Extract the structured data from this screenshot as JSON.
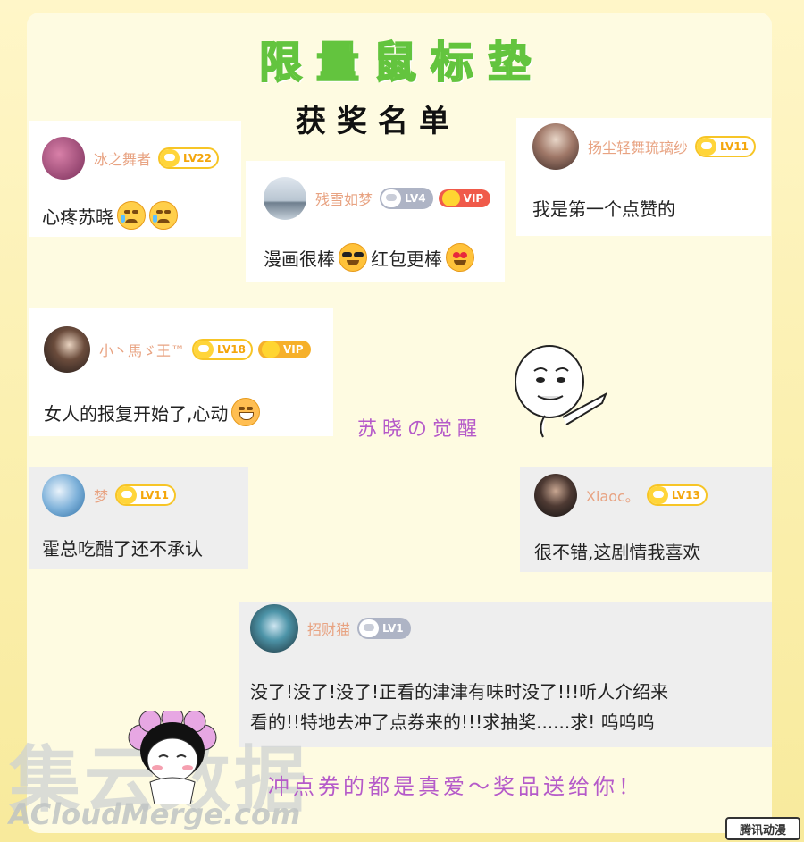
{
  "title": "限量鼠标垫",
  "subtitle": "获奖名单",
  "cards": [
    {
      "user": "冰之舞者",
      "level": "LV22",
      "comment": "心疼苏晓",
      "avatar_color": "#b0527a"
    },
    {
      "user": "残雪如梦",
      "level": "LV4",
      "vip": "VIP",
      "comment_a": "漫画很棒",
      "comment_b": "红包更棒",
      "avatar_color": "#9aa8b6"
    },
    {
      "user": "扬尘轻舞琉璃纱",
      "level": "LV11",
      "comment": "我是第一个点赞的",
      "avatar_color": "#8a6a5a"
    },
    {
      "user": "小丶馬ゞ王™",
      "level": "LV18",
      "vip": "VIP",
      "comment": "女人的报复开始了,心动",
      "avatar_color": "#3a3030"
    },
    {
      "user": "梦",
      "level": "LV11",
      "comment": "霍总吃醋了还不承认",
      "avatar_color": "#5b97c8"
    },
    {
      "user": "Xiaoc。",
      "level": "LV13",
      "comment": "很不错,这剧情我喜欢",
      "avatar_color": "#2e2e34"
    },
    {
      "user": "招财猫",
      "level": "LV1",
      "comment_line1": "没了!没了!没了!正看的津津有味时没了!!!听人介绍来",
      "comment_line2": "看的!!特地去冲了点券来的!!!求抽奖......求!  呜呜呜",
      "avatar_color": "#2f6a78"
    }
  ],
  "caption_middle": "苏晓の觉醒",
  "caption_bottom": "冲点券的都是真爱～奖品送给你！",
  "watermark": "集云数据",
  "watermark_url": "ACloudMerge.com",
  "logo": "腾讯动漫",
  "colors": {
    "title_green": "#8ee36a",
    "username": "#e8a382",
    "caption": "#b55ac9",
    "vip": "#f05a4a",
    "level_gold": "#f7c526"
  }
}
